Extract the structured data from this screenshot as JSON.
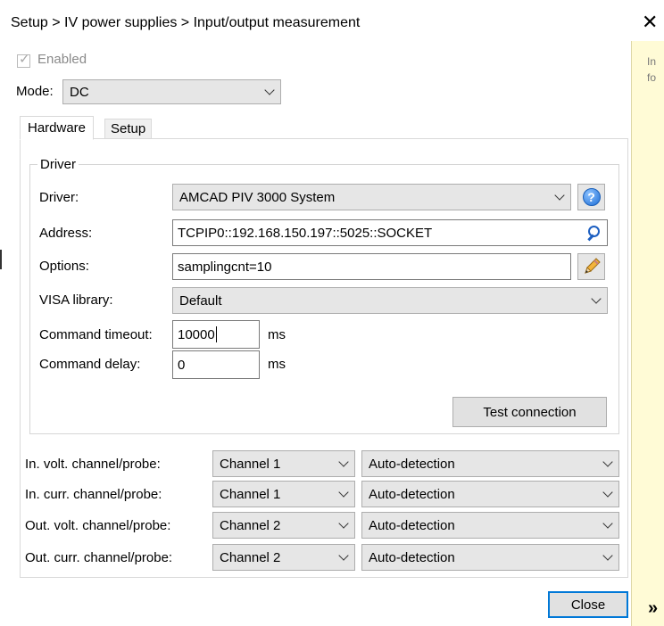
{
  "window": {
    "title": "Setup > IV power supplies > Input/output measurement",
    "close_glyph": "✕"
  },
  "info_panel": {
    "text": "Info",
    "expand_glyph": "»"
  },
  "enabled": {
    "label": "Enabled",
    "checked": true
  },
  "mode": {
    "label": "Mode:",
    "value": "DC"
  },
  "tabs": [
    {
      "label": "Hardware",
      "active": true
    },
    {
      "label": "Setup",
      "active": false
    }
  ],
  "driver_group": {
    "legend": "Driver",
    "driver": {
      "label": "Driver:",
      "value": "AMCAD PIV 3000 System"
    },
    "address": {
      "label": "Address:",
      "value": "TCPIP0::192.168.150.197::5025::SOCKET"
    },
    "options": {
      "label": "Options:",
      "value": "samplingcnt=10"
    },
    "visa_library": {
      "label": "VISA library:",
      "value": "Default"
    },
    "command_timeout": {
      "label": "Command timeout:",
      "value": "10000",
      "unit": "ms"
    },
    "command_delay": {
      "label": "Command delay:",
      "value": "0",
      "unit": "ms"
    },
    "test_button": "Test connection"
  },
  "channels": [
    {
      "label": "In. volt. channel/probe:",
      "channel": "Channel 1",
      "probe": "Auto-detection"
    },
    {
      "label": "In. curr. channel/probe:",
      "channel": "Channel 1",
      "probe": "Auto-detection"
    },
    {
      "label": "Out. volt. channel/probe:",
      "channel": "Channel 2",
      "probe": "Auto-detection"
    },
    {
      "label": "Out. curr. channel/probe:",
      "channel": "Channel 2",
      "probe": "Auto-detection"
    }
  ],
  "close_button": "Close",
  "colors": {
    "info_panel_bg": "#fffbd6",
    "focus_accent": "#0078d7",
    "help_icon": "#1f6fd6"
  },
  "icons": [
    "check-icon",
    "chevron-down-icon",
    "help-icon",
    "search-icon",
    "pencil-icon",
    "close-icon",
    "double-chevron-right-icon"
  ]
}
